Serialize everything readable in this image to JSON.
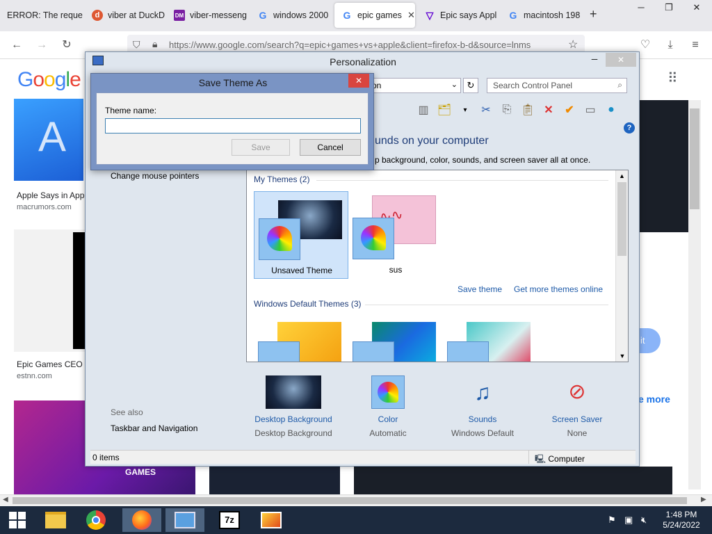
{
  "browser": {
    "tabs": [
      {
        "label": "ERROR: The reque",
        "icon": "error-page-icon",
        "active": false
      },
      {
        "label": "viber at DuckD",
        "icon": "duckduckgo-icon",
        "active": false
      },
      {
        "label": "viber-messeng",
        "icon": "dm-icon",
        "active": false
      },
      {
        "label": "windows 2000",
        "icon": "google-g-icon",
        "active": false
      },
      {
        "label": "epic games",
        "icon": "google-g-icon",
        "active": true
      },
      {
        "label": "Epic says Appl",
        "icon": "yahoo-icon",
        "active": false
      },
      {
        "label": "macintosh 198",
        "icon": "google-g-icon",
        "active": false
      }
    ],
    "new_tab": "+",
    "url": "https://www.google.com/search?q=epic+games+vs+apple&client=firefox-b-d&source=lnms"
  },
  "google": {
    "logo": "Google",
    "results": [
      {
        "title": "Apple Says in App",
        "source": "macrumors.com"
      },
      {
        "title": "Epic Games CEO I",
        "source": "estnn.com"
      }
    ],
    "games_label": "GAMES",
    "right_peek": "e more",
    "button_peek": "it"
  },
  "personalization": {
    "title": "Personalization",
    "address_text": "on",
    "search_placeholder": "Search Control Panel",
    "heading": "unds on your computer",
    "subheading": "p background, color, sounds, and screen saver all at once.",
    "left_link": "Change mouse pointers",
    "see_also": "See also",
    "see_also_link": "Taskbar and Navigation",
    "my_themes": "My Themes (2)",
    "themes": [
      {
        "name": "Unsaved Theme"
      },
      {
        "name": "sus"
      }
    ],
    "save_theme": "Save theme",
    "get_more": "Get more themes online",
    "default_themes": "Windows Default Themes (3)",
    "bottom_items": [
      {
        "label": "Desktop Background",
        "value": "Desktop Background",
        "icon": "desktop-background-icon"
      },
      {
        "label": "Color",
        "value": "Automatic",
        "icon": "color-icon"
      },
      {
        "label": "Sounds",
        "value": "Windows Default",
        "icon": "sounds-icon"
      },
      {
        "label": "Screen Saver",
        "value": "None",
        "icon": "screen-saver-icon"
      }
    ],
    "status_items": "0 items",
    "status_computer": "Computer"
  },
  "dialog": {
    "title": "Save Theme As",
    "field_label": "Theme name:",
    "field_value": "",
    "save": "Save",
    "cancel": "Cancel"
  },
  "taskbar": {
    "time": "1:48 PM",
    "date": "5/24/2022"
  },
  "colors": {
    "accent_blue": "#1e5aa8",
    "dialog_frame": "#7a94c4",
    "close_red": "#d9453f",
    "taskbar": "#1c2a3e"
  }
}
